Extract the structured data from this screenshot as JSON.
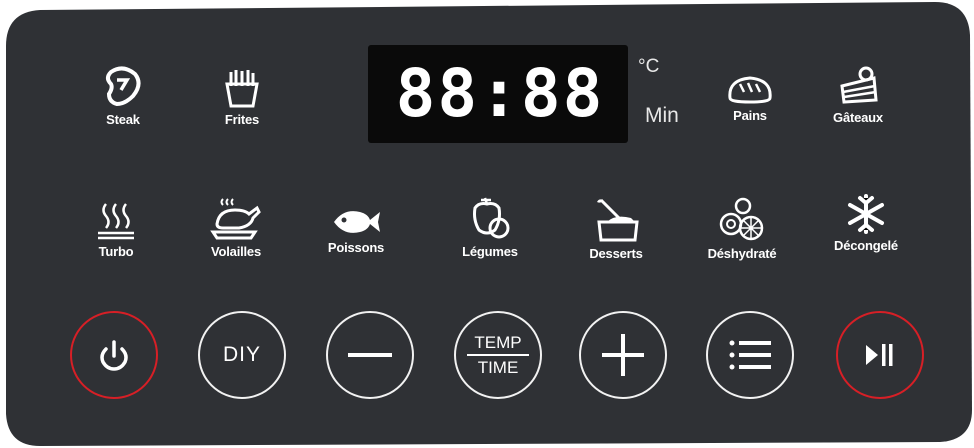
{
  "display": {
    "digits": "88:88",
    "unit_celsius": "°C",
    "unit_min": "Min"
  },
  "modes_top": [
    {
      "label": "Steak",
      "icon": "steak-icon"
    },
    {
      "label": "Frites",
      "icon": "fries-icon"
    },
    {
      "label": "Pains",
      "icon": "bread-icon"
    },
    {
      "label": "Gâteaux",
      "icon": "cake-icon"
    }
  ],
  "modes_bottom": [
    {
      "label": "Turbo",
      "icon": "heat-waves-icon"
    },
    {
      "label": "Volailles",
      "icon": "chicken-icon"
    },
    {
      "label": "Poissons",
      "icon": "fish-icon"
    },
    {
      "label": "Légumes",
      "icon": "vegetables-icon"
    },
    {
      "label": "Desserts",
      "icon": "dessert-icon"
    },
    {
      "label": "Déshydraté",
      "icon": "dried-fruit-icon"
    },
    {
      "label": "Décongelé",
      "icon": "snowflake-icon"
    }
  ],
  "buttons": {
    "diy": "DIY",
    "temp": "TEMP",
    "time": "TIME"
  },
  "colors": {
    "panel": "#2f3135",
    "accent_red": "#d71f26",
    "text": "#ffffff",
    "display_bg": "#0a0a0a"
  }
}
